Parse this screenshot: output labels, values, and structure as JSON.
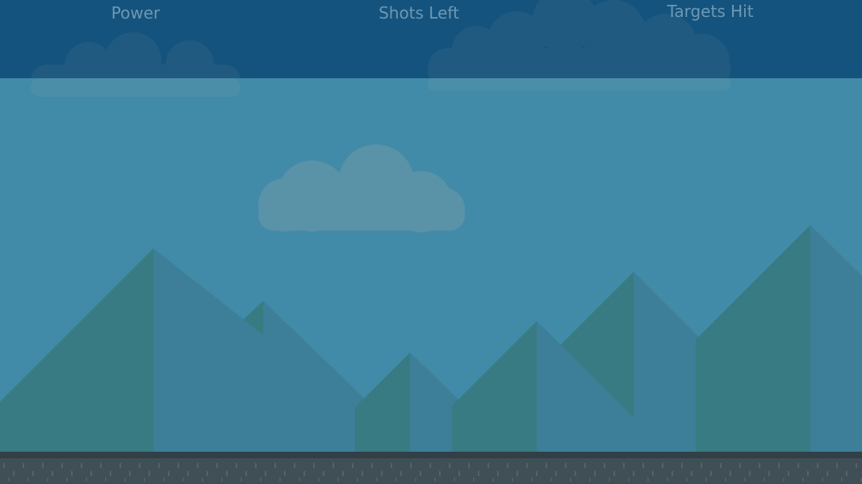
{
  "hud": {
    "power_label": "Power",
    "shots_left_label": "Shots Left",
    "targets_hit_label": "Targets Hit"
  },
  "colors": {
    "sky": "#418ba8",
    "hud_bar": "#14537d",
    "hud_text": "#6e97b4",
    "mountain_light": "#3d7e98",
    "mountain_dark": "#387b82",
    "cloud": "#5f94a8",
    "ground": "#404f55"
  },
  "icons": [
    "cloud-icon",
    "mountain-icon"
  ]
}
